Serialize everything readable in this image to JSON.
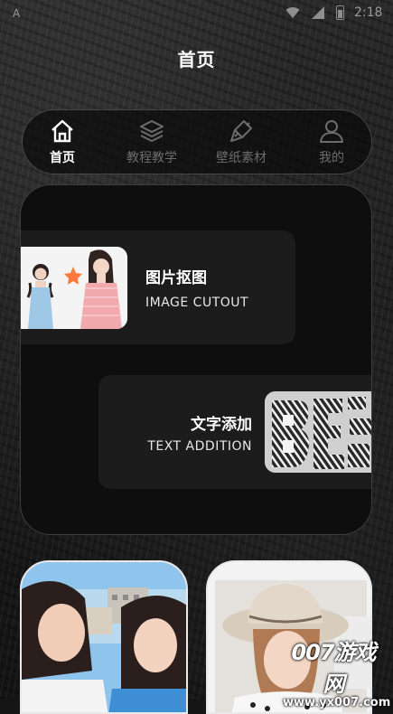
{
  "status_bar": {
    "time": "2:18",
    "left_icon": "A"
  },
  "header": {
    "title": "首页"
  },
  "tabs": [
    {
      "label": "首页",
      "icon": "home-icon",
      "active": true
    },
    {
      "label": "教程教学",
      "icon": "layers-icon",
      "active": false
    },
    {
      "label": "壁纸素材",
      "icon": "brush-icon",
      "active": false
    },
    {
      "label": "我的",
      "icon": "user-icon",
      "active": false
    }
  ],
  "features": [
    {
      "title": "图片抠图",
      "subtitle": "IMAGE CUTOUT"
    },
    {
      "title": "文字添加",
      "subtitle": "TEXT ADDITION"
    }
  ],
  "watermark": {
    "line1": "007游戏网",
    "line2": "www.yx007.com"
  },
  "colors": {
    "background": "#151515",
    "card": "#1c1c1c",
    "active_tab": "#ffffff",
    "inactive_tab": "#6c6c6c"
  }
}
